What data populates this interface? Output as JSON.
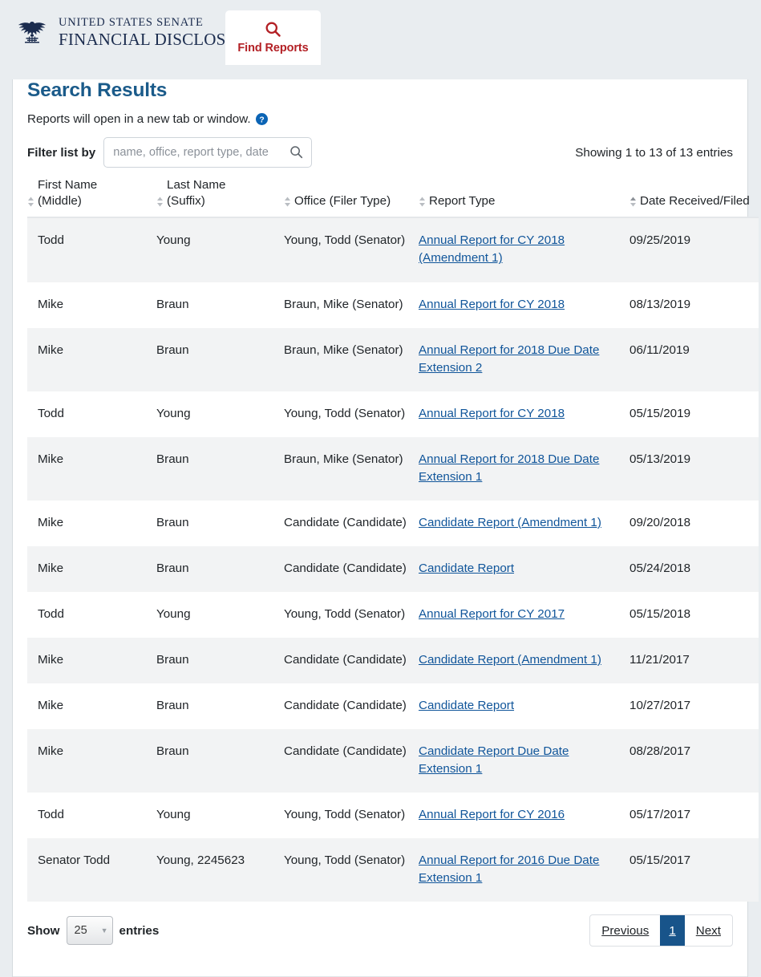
{
  "header": {
    "logo_icon": "senate-eagle-seal-icon",
    "brand_line1": "UNITED STATES SENATE",
    "brand_line2": "FINANCIAL DISCLOSURES",
    "tab": {
      "icon": "search-icon",
      "label": "Find Reports"
    }
  },
  "main": {
    "title": "Search Results",
    "note": "Reports will open in a new tab or window.",
    "help_icon": "question-circle-icon",
    "filter_label": "Filter list by",
    "filter_placeholder": "name, office, report type, date",
    "filter_value": "",
    "entries_info": "Showing 1 to 13 of 13 entries",
    "columns": [
      {
        "line1": "First Name",
        "line2": "(Middle)"
      },
      {
        "line1": "Last Name",
        "line2": "(Suffix)"
      },
      {
        "line1": "",
        "line2": "Office (Filer Type)"
      },
      {
        "line1": "",
        "line2": "Report Type"
      },
      {
        "line1": "",
        "line2": "Date Received/Filed"
      }
    ],
    "rows": [
      {
        "first": "Todd",
        "last": "Young",
        "office": "Young, Todd (Senator)",
        "report": "Annual Report for CY 2018 (Amendment 1)",
        "date": "09/25/2019"
      },
      {
        "first": "Mike",
        "last": "Braun",
        "office": "Braun, Mike (Senator)",
        "report": "Annual Report for CY 2018",
        "date": "08/13/2019"
      },
      {
        "first": "Mike",
        "last": "Braun",
        "office": "Braun, Mike (Senator)",
        "report": "Annual Report for 2018 Due Date Extension 2",
        "date": "06/11/2019"
      },
      {
        "first": "Todd",
        "last": "Young",
        "office": "Young, Todd (Senator)",
        "report": "Annual Report for CY 2018",
        "date": "05/15/2019"
      },
      {
        "first": "Mike",
        "last": "Braun",
        "office": "Braun, Mike (Senator)",
        "report": "Annual Report for 2018 Due Date Extension 1",
        "date": "05/13/2019"
      },
      {
        "first": "Mike",
        "last": "Braun",
        "office": "Candidate (Candidate)",
        "report": "Candidate Report (Amendment 1)",
        "date": "09/20/2018"
      },
      {
        "first": "Mike",
        "last": "Braun",
        "office": "Candidate (Candidate)",
        "report": "Candidate Report",
        "date": "05/24/2018"
      },
      {
        "first": "Todd",
        "last": "Young",
        "office": "Young, Todd (Senator)",
        "report": "Annual Report for CY 2017",
        "date": "05/15/2018"
      },
      {
        "first": "Mike",
        "last": "Braun",
        "office": "Candidate (Candidate)",
        "report": "Candidate Report (Amendment 1)",
        "date": "11/21/2017"
      },
      {
        "first": "Mike",
        "last": "Braun",
        "office": "Candidate (Candidate)",
        "report": "Candidate Report",
        "date": "10/27/2017"
      },
      {
        "first": "Mike",
        "last": "Braun",
        "office": "Candidate (Candidate)",
        "report": "Candidate Report Due Date Extension 1",
        "date": "08/28/2017"
      },
      {
        "first": "Todd",
        "last": "Young",
        "office": "Young, Todd (Senator)",
        "report": "Annual Report for CY 2016",
        "date": "05/17/2017"
      },
      {
        "first": "Senator Todd",
        "last": "Young, 2245623",
        "office": "Young, Todd (Senator)",
        "report": "Annual Report for 2016 Due Date Extension 1",
        "date": "05/15/2017"
      }
    ],
    "footer": {
      "show_label": "Show",
      "page_length": "25",
      "entries_label": "entries",
      "previous_label": "Previous",
      "current_page": "1",
      "next_label": "Next"
    }
  },
  "colors": {
    "brand_navy": "#1b2c4e",
    "tab_red": "#b32025",
    "title_blue": "#1b5b8a",
    "link_blue": "#10559a",
    "pager_active": "#18548a",
    "row_alt": "#f2f3f4",
    "page_bg": "#e9edf0"
  }
}
